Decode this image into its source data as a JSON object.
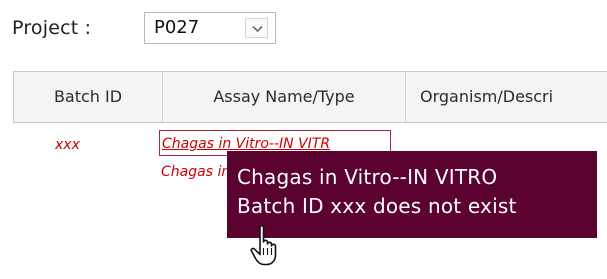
{
  "project": {
    "label": "Project :",
    "selected_value": "P027",
    "icon": "chevron-down-icon"
  },
  "table": {
    "columns": [
      {
        "label": "Batch ID"
      },
      {
        "label": "Assay Name/Type"
      },
      {
        "label": "Organism/Descri"
      }
    ],
    "rows": [
      {
        "batch_id": "xxx",
        "assay_name": "Chagas in Vitro--IN VITR",
        "assay_name_second": "Chagas in Vitro--IN VITRO"
      }
    ]
  },
  "tooltip": {
    "line1": "Chagas in Vitro--IN VITRO",
    "line2": "Batch ID xxx does not exist"
  },
  "cursor": {
    "icon": "hand-pointer-icon"
  },
  "colors": {
    "tooltip_background": "#5b0230",
    "link_text": "#cc0000",
    "header_background": "#f4f4f4"
  }
}
